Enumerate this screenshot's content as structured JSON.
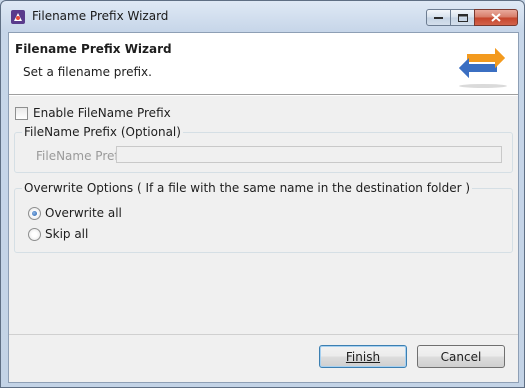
{
  "window": {
    "title": "Filename Prefix Wizard"
  },
  "banner": {
    "title": "Filename Prefix Wizard",
    "subtitle": "Set a filename prefix."
  },
  "enable_prefix": {
    "label": "Enable FileName Prefix",
    "checked": false
  },
  "prefix_group": {
    "label": "FileName Prefix (Optional)",
    "field_label": "FileName Prefix",
    "field_value": ""
  },
  "overwrite_group": {
    "label": "Overwrite Options ( If a file with the same name in the destination folder )",
    "options": [
      {
        "label": "Overwrite all",
        "selected": true
      },
      {
        "label": "Skip all",
        "selected": false
      }
    ]
  },
  "buttons": {
    "finish": "Finish",
    "cancel": "Cancel"
  },
  "colors": {
    "accent": "#1f5fae",
    "arrow_orange": "#f39a1e",
    "arrow_blue": "#3b6fc2"
  },
  "icons": {
    "app": "wizard-app-icon",
    "banner": "bidirectional-arrows-icon"
  }
}
